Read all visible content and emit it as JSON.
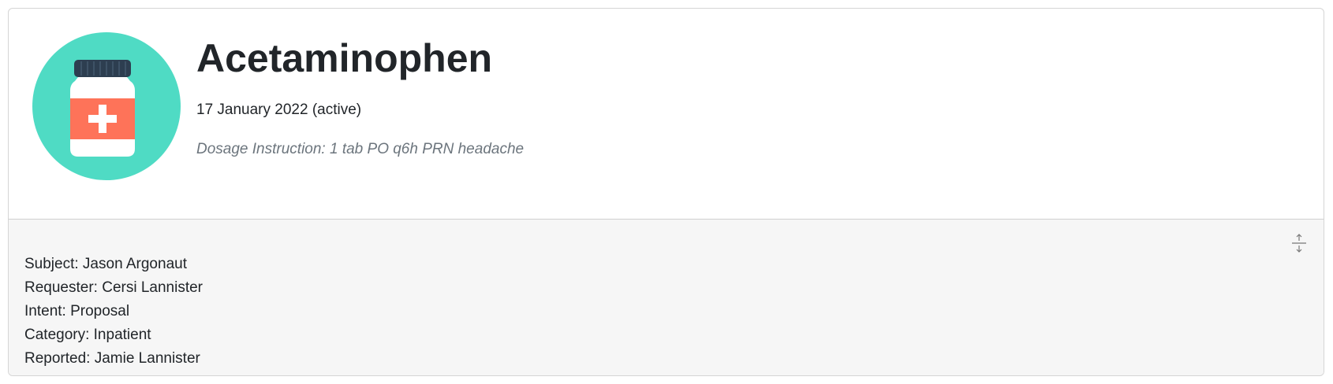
{
  "medication": {
    "icon": "medicine-bottle-icon",
    "name": "Acetaminophen",
    "date_status": "17 January 2022 (active)",
    "dosage_instruction": "Dosage Instruction: 1 tab PO q6h PRN headache"
  },
  "footer": {
    "toggle_icon": "collapse-vertical-icon",
    "details": [
      "Subject: Jason Argonaut",
      "Requester: Cersi Lannister",
      "Intent: Proposal",
      "Category: Inpatient",
      "Reported: Jamie Lannister"
    ]
  },
  "colors": {
    "icon_circle": "#4fdbc4",
    "bottle_cap": "#2d3e50",
    "bottle_body": "#ffffff",
    "bottle_label": "#fe7359",
    "footer_background": "#f6f6f6",
    "muted_text": "#6c757d"
  }
}
